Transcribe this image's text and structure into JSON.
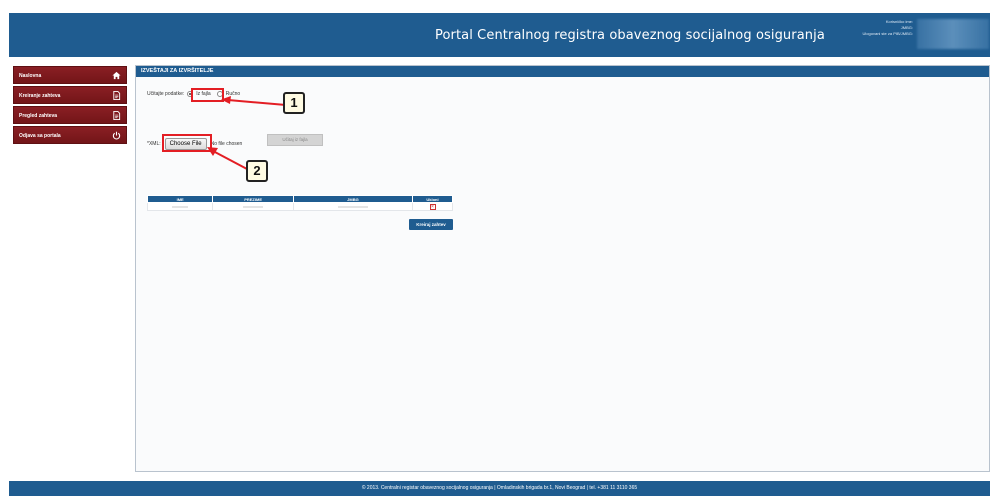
{
  "header": {
    "title": "Portal Centralnog registra obaveznog socijalnog osiguranja",
    "user_label": "Korisničko ime:",
    "jmbg_label": "JMBG:",
    "logged_label": "Ulogovani ste za PIB/JMBG:"
  },
  "sidebar": {
    "items": [
      {
        "label": "Naslovna",
        "icon": "home-icon"
      },
      {
        "label": "Kreiranje zahteva",
        "icon": "document-icon"
      },
      {
        "label": "Pregled zahteva",
        "icon": "document-icon"
      },
      {
        "label": "Odjava sa portala",
        "icon": "power-icon"
      }
    ]
  },
  "main": {
    "section_title": "IZVEŠTAJI ZA IZVRŠITELJE",
    "load_label": "Učitajte podatke:",
    "option_file": "Iz fajla",
    "option_manual": "Ručno",
    "xml_label": "*XML:",
    "choose_file": "Choose File",
    "no_file": "No file chosen",
    "load_button": "Učitaj iz fajla",
    "table": {
      "columns": [
        "IME",
        "PREZIME",
        "JMBG",
        "Ukloni"
      ]
    },
    "create_button": "Kreiraj zahtev"
  },
  "callouts": [
    "1",
    "2"
  ],
  "footer": {
    "text": "© 2013. Centralni registar obaveznog socijalnog osiguranja | Omladinskih brigada br.1, Novi Beograd | tel. +381 11 3110 365"
  },
  "colors": {
    "primary": "#1f5c90",
    "nav": "#7d1a1e",
    "highlight": "#e31e24"
  }
}
